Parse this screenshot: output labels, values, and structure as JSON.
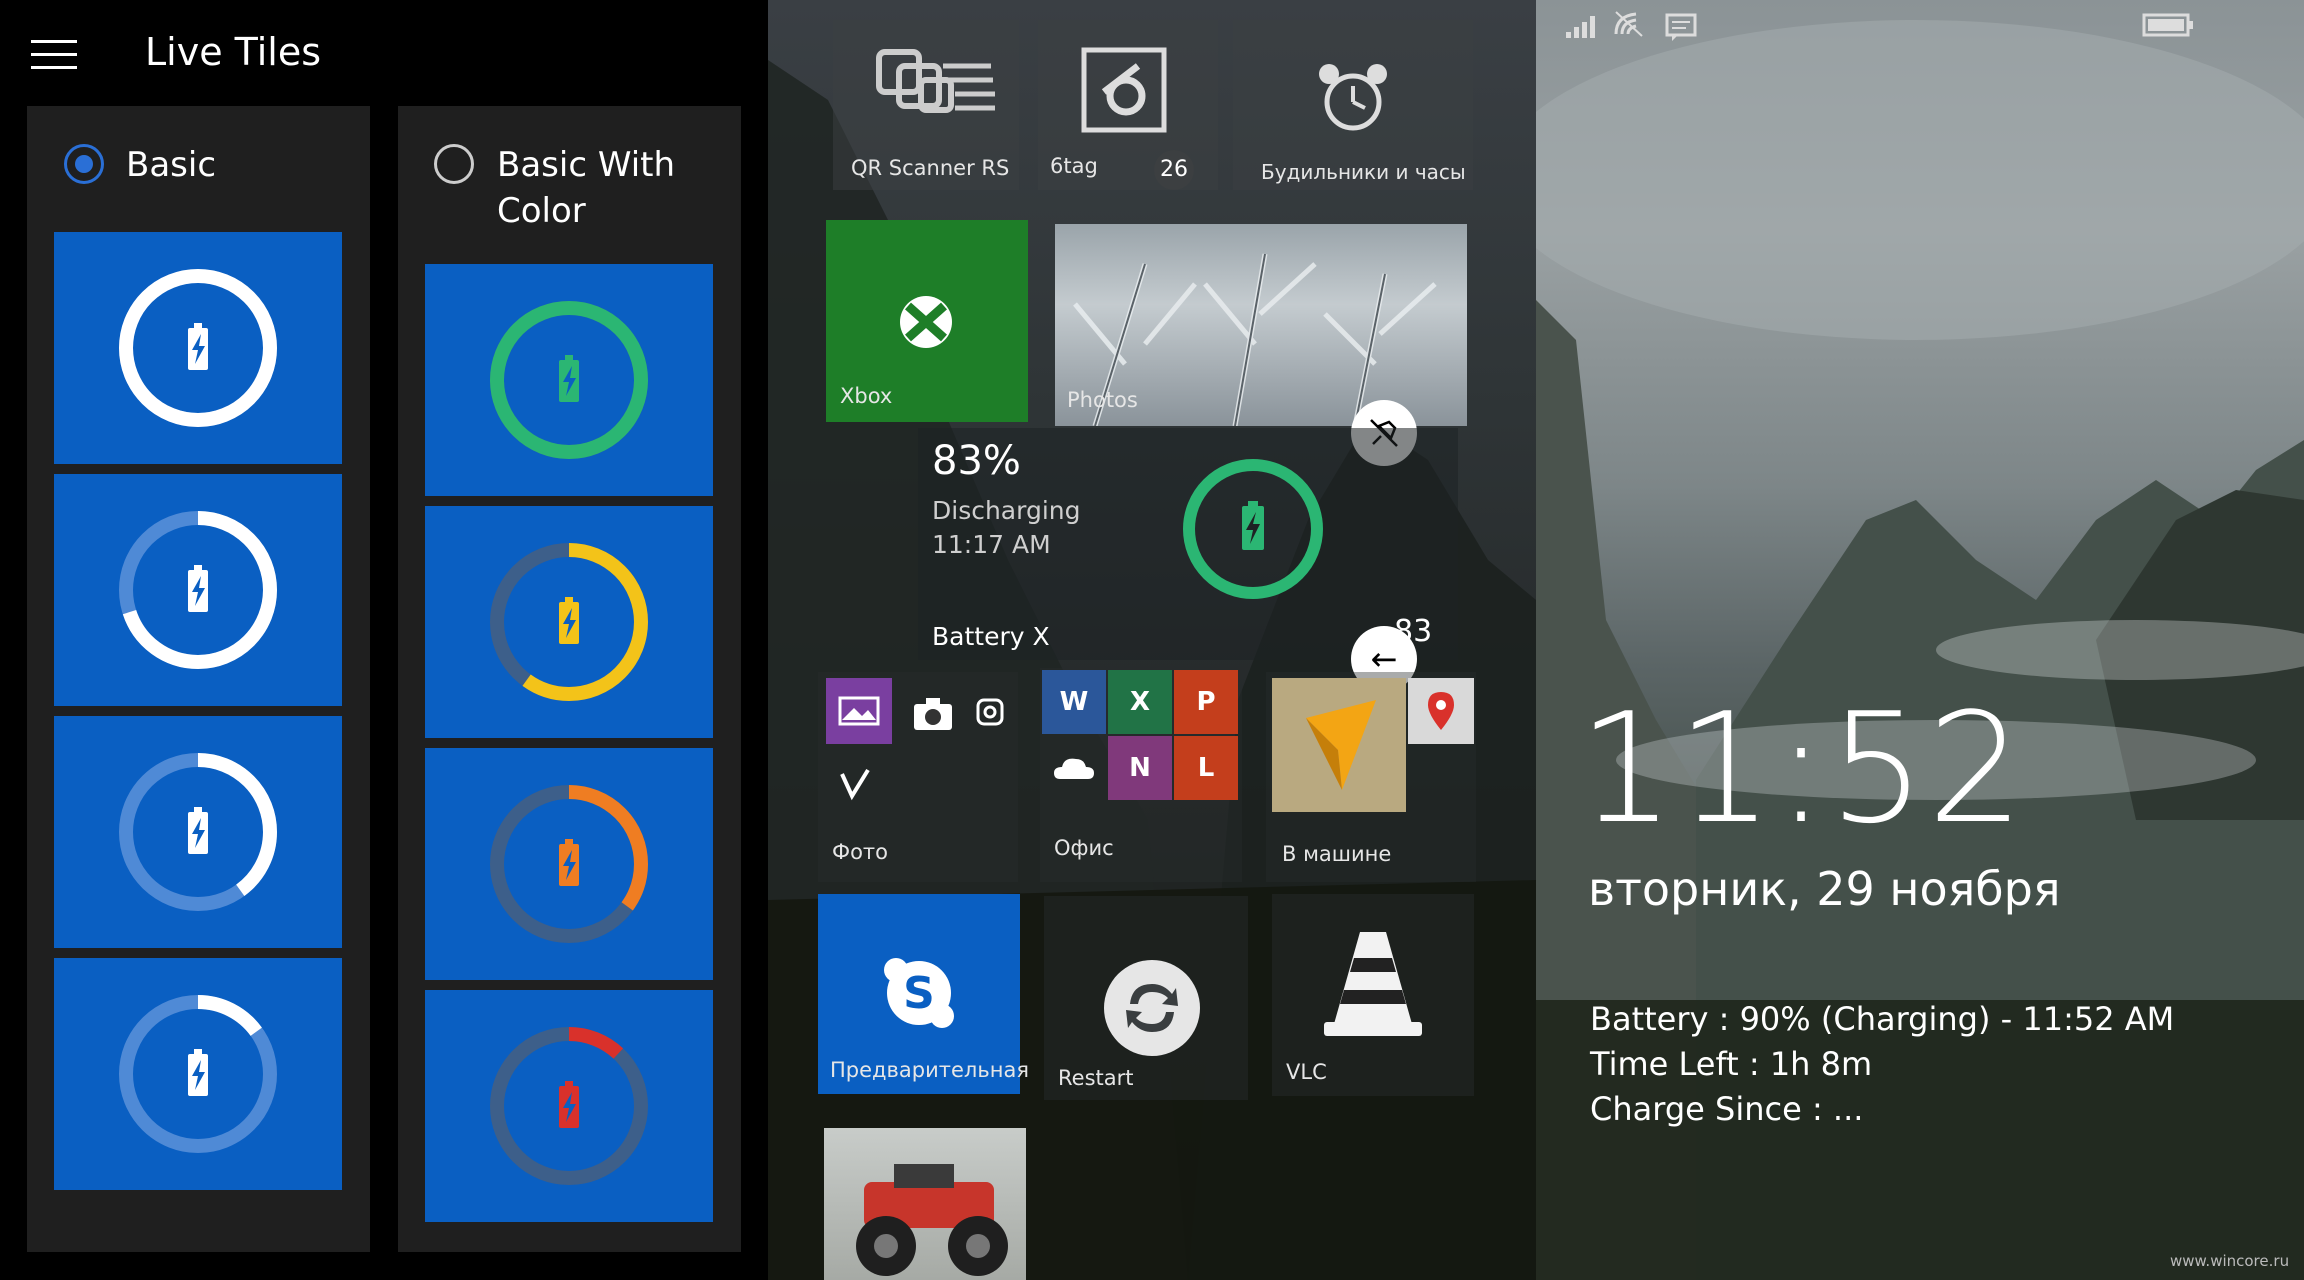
{
  "screen1": {
    "title": "Live Tiles",
    "options": [
      {
        "label": "Basic",
        "selected": true
      },
      {
        "label_line1": "Basic With",
        "label_line2": "Color",
        "selected": false
      }
    ],
    "basic_levels": [
      1.0,
      0.7,
      0.4,
      0.15
    ],
    "color_levels": [
      {
        "level": 1.0,
        "color": "#2bb673"
      },
      {
        "level": 0.6,
        "color": "#f3c319"
      },
      {
        "level": 0.35,
        "color": "#ef7d22"
      },
      {
        "level": 0.12,
        "color": "#d9312b"
      }
    ],
    "accent": "#0a5fc2"
  },
  "screen2": {
    "tiles": {
      "qr_label": "QR Scanner RS",
      "sixtag_label": "6tag",
      "sixtag_badge": "26",
      "alarms_label": "Будильники и часы",
      "xbox_label": "Xbox",
      "photos_label": "Photos",
      "battery_percent": "83%",
      "battery_status": "Discharging",
      "battery_time": "11:17 AM",
      "battery_name": "Battery X",
      "battery_badge": "83",
      "foto_label": "Фото",
      "office_label": "Офис",
      "car_label": "В машине",
      "skype_label": "Предварительная",
      "restart_label": "Restart",
      "vlc_label": "VLC"
    },
    "colors": {
      "xbox": "#1e7e28",
      "skype": "#0a5fc2",
      "battery_ring": "#2bb673"
    }
  },
  "screen3": {
    "time": "11:52",
    "date": "вторник, 29 ноября",
    "battery_line": "Battery : 90% (Charging) - 11:52 AM",
    "time_left_line": "Time Left : 1h 8m",
    "charge_since_line": "Charge Since : ...",
    "watermark": "www.wincore.ru"
  }
}
